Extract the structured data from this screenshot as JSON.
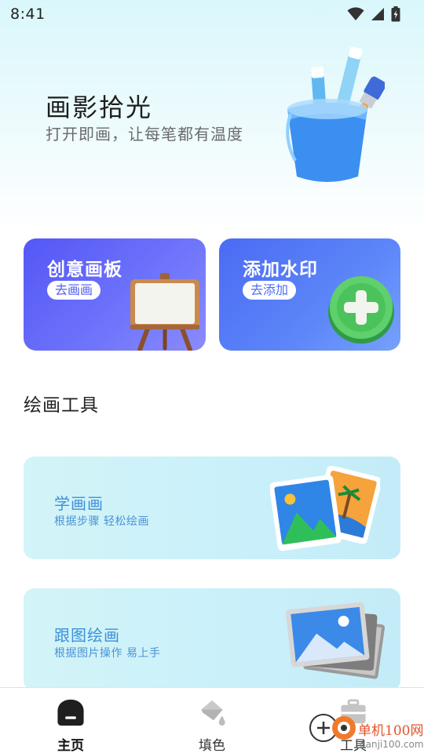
{
  "status_bar": {
    "time": "8:41",
    "icons": [
      "wifi-icon",
      "signal-icon",
      "battery-icon"
    ]
  },
  "hero": {
    "title": "画影拾光",
    "subtitle": "打开即画，让每笔都有温度",
    "illustration": "paint-bucket-icon"
  },
  "features": [
    {
      "title": "创意画板",
      "action": "去画画",
      "icon": "easel-icon"
    },
    {
      "title": "添加水印",
      "action": "去添加",
      "icon": "plus-circle-icon"
    }
  ],
  "section": {
    "title": "绘画工具"
  },
  "tools": [
    {
      "title": "学画画",
      "subtitle": "根据步骤 轻松绘画",
      "icon": "photos-icon"
    },
    {
      "title": "跟图绘画",
      "subtitle": "根据图片操作 易上手",
      "icon": "picture-frames-icon"
    }
  ],
  "nav": {
    "items": [
      {
        "label": "主页",
        "icon": "home-icon",
        "active": true
      },
      {
        "label": "填色",
        "icon": "paint-bucket-icon",
        "active": false
      },
      {
        "label": "工具",
        "icon": "toolbox-icon",
        "active": false
      }
    ]
  },
  "watermark": {
    "line1": "单机100网",
    "line2": "danji100.com"
  },
  "colors": {
    "card_left": "#5457f5",
    "card_right": "#4b6bf3",
    "tool_bg": "#c9f0fa",
    "tool_text": "#3d8fd8",
    "watermark_red": "#e0542a"
  }
}
